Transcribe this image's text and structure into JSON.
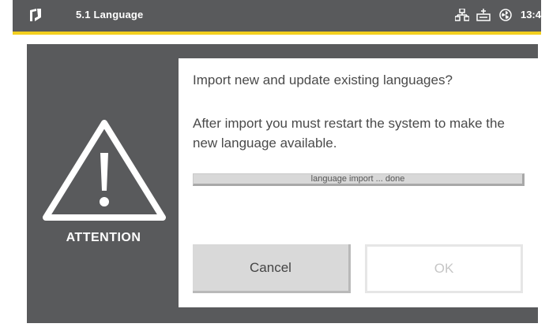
{
  "header": {
    "title": "5.1 Language",
    "clock": "13:4",
    "logo_icon": "app-logo-icon",
    "status_icons": [
      "network-icon",
      "usb-drive-icon",
      "fan-icon"
    ]
  },
  "colors": {
    "header_bg": "#595a5c",
    "accent": "#f3cf1f",
    "overlay_bg": "#595a5c",
    "dialog_bg": "#ffffff"
  },
  "warning": {
    "icon": "warning-triangle-icon",
    "label": "ATTENTION"
  },
  "dialog": {
    "question": "Import new and update existing languages?",
    "message": "After import you must restart the system to make the new language available.",
    "progress": {
      "text": "language import ... done",
      "fraction": 1.0
    },
    "cancel_label": "Cancel",
    "ok_label": "OK"
  }
}
